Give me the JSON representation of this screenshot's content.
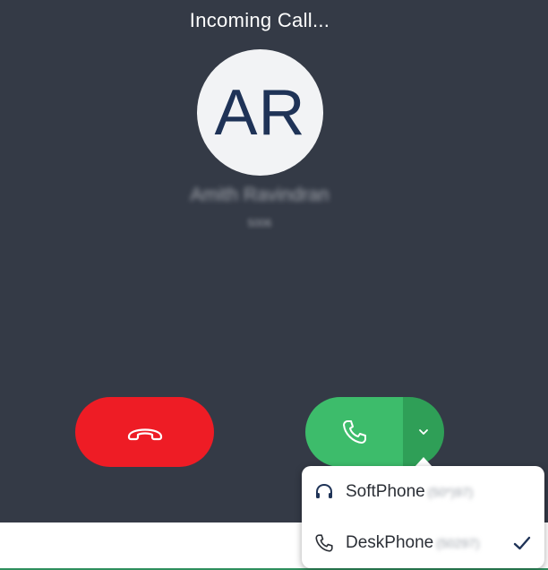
{
  "call": {
    "status": "Incoming Call...",
    "avatar_initials": "AR",
    "caller_name": "Amith Ravindran",
    "caller_subtitle": "5006"
  },
  "actions": {
    "decline_icon": "hang-up-icon",
    "answer_icon": "phone-icon",
    "options_icon": "chevron-down-icon"
  },
  "device_menu": {
    "items": [
      {
        "label": "SoftPhone",
        "extra": "(50*)97)",
        "icon": "headset-icon",
        "selected": false
      },
      {
        "label": "DeskPhone",
        "extra": "(50297)",
        "icon": "phone-icon",
        "selected": true
      }
    ]
  },
  "colors": {
    "panel_bg": "#343a46",
    "decline": "#ee1c25",
    "answer": "#3dbc6b",
    "answer_dark": "#2f9f57",
    "avatar_bg": "#f2f3f5",
    "avatar_text": "#1f3357",
    "menu_icon": "#1f3357"
  }
}
